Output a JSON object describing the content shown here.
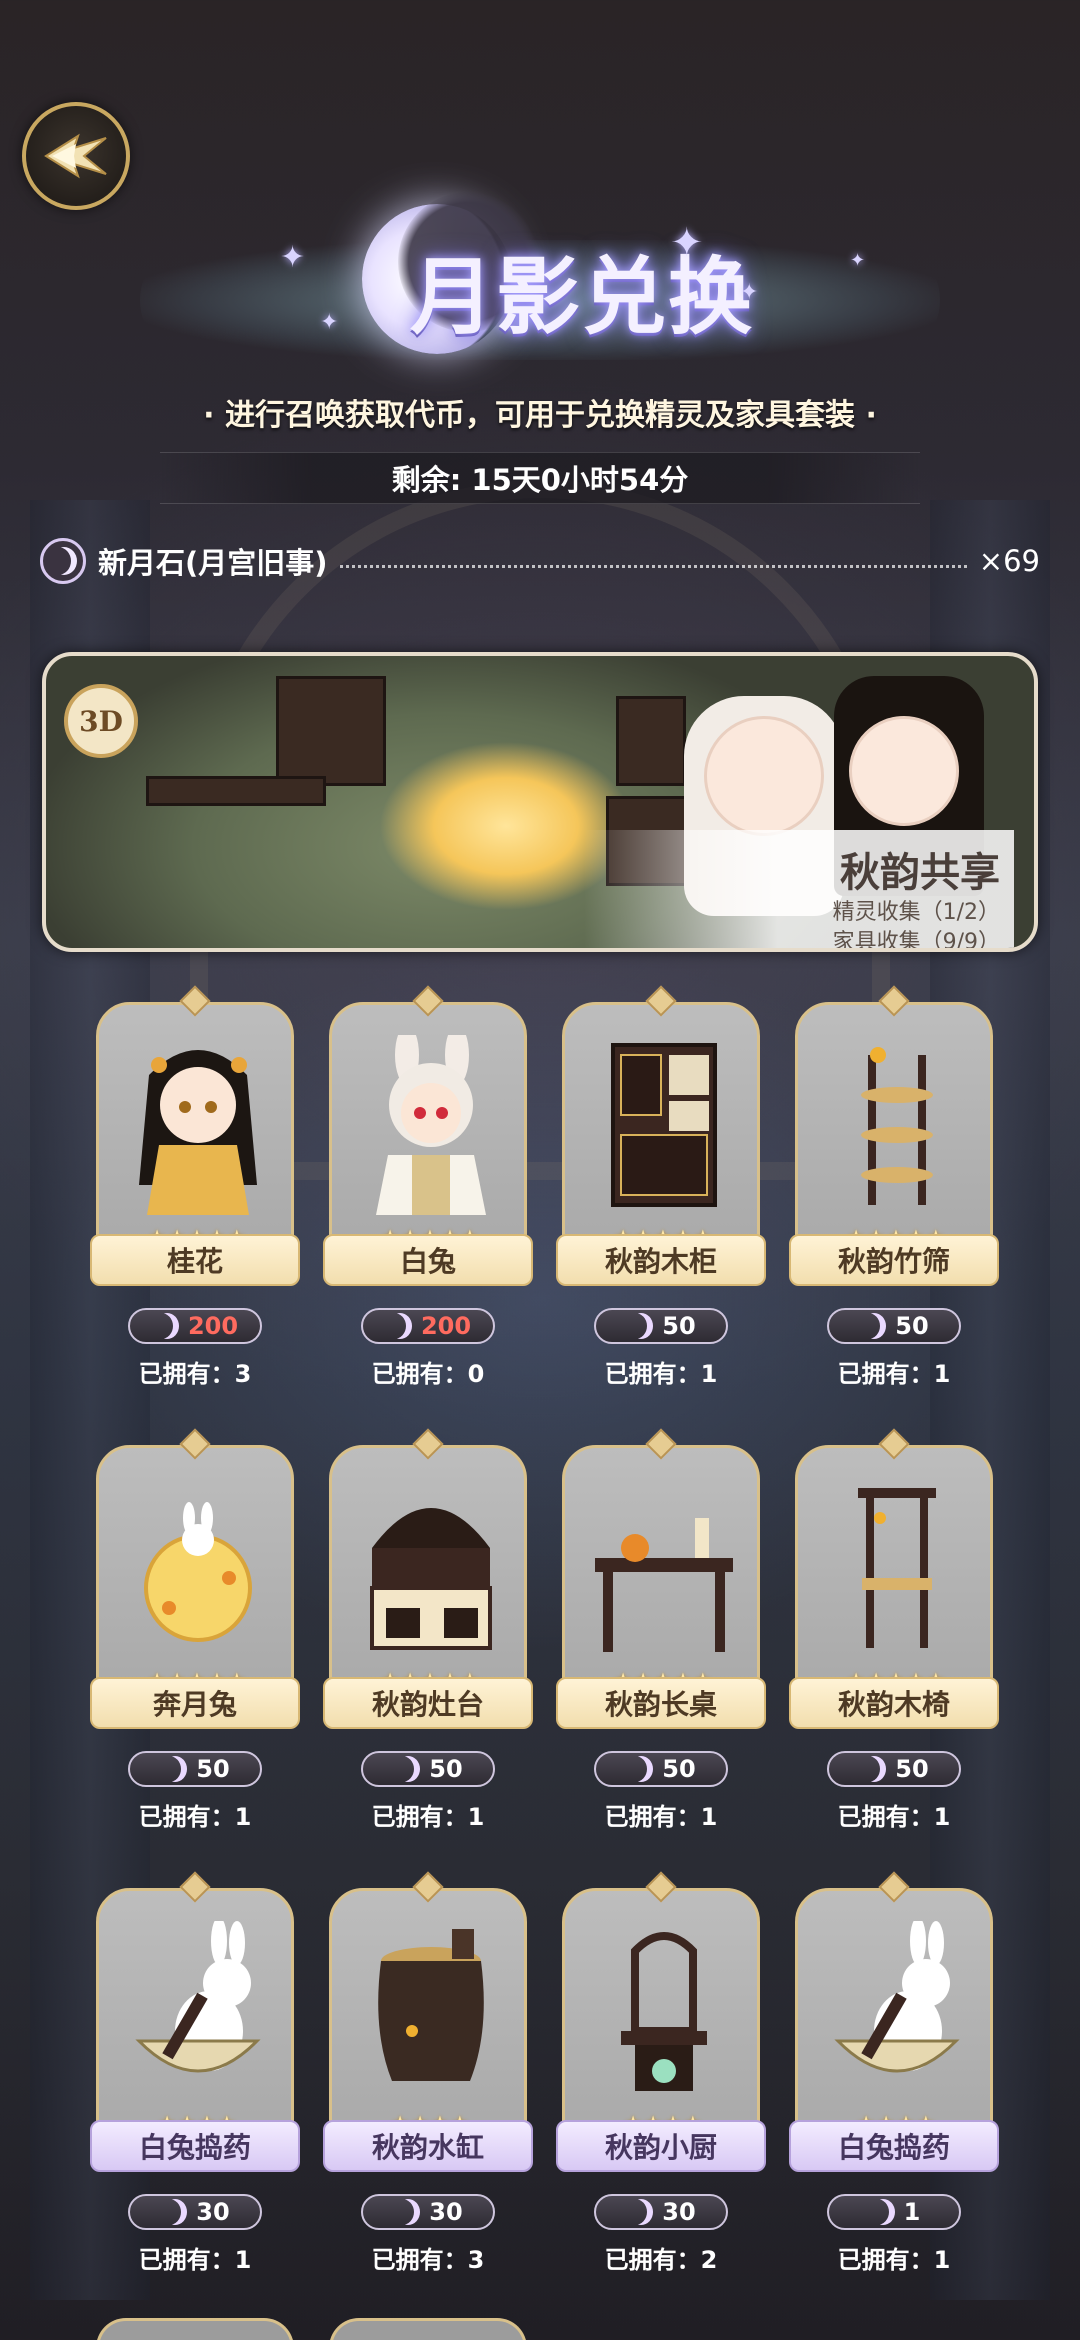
{
  "header": {
    "title": "月影兑换",
    "subtitle": "· 进行召唤获取代币，可用于兑换精灵及家具套装 ·",
    "remaining": "剩余: 15天0小时54分"
  },
  "currency": {
    "name": "新月石(月宫旧事)",
    "count": "×69"
  },
  "banner": {
    "badge": "3D",
    "set_name": "秋韵共享",
    "spirit_collect": "精灵收集（1/2）",
    "furniture_collect": "家具收集（9/9）"
  },
  "items": [
    {
      "name": "桂花",
      "price": "200",
      "owned": "已拥有：3",
      "stars": "★★★★★",
      "plate": "gold",
      "price_red": true,
      "art": "girl"
    },
    {
      "name": "白兔",
      "price": "200",
      "owned": "已拥有：0",
      "stars": "★★★★★",
      "plate": "gold",
      "price_red": true,
      "art": "bunnyboy"
    },
    {
      "name": "秋韵木柜",
      "price": "50",
      "owned": "已拥有：1",
      "stars": "★★★★★",
      "plate": "gold",
      "price_red": false,
      "art": "cabinet"
    },
    {
      "name": "秋韵竹筛",
      "price": "50",
      "owned": "已拥有：1",
      "stars": "★★★★★",
      "plate": "gold",
      "price_red": false,
      "art": "sieve"
    },
    {
      "name": "奔月兔",
      "price": "50",
      "owned": "已拥有：1",
      "stars": "★★★★★",
      "plate": "gold",
      "price_red": false,
      "art": "moonrabbit"
    },
    {
      "name": "秋韵灶台",
      "price": "50",
      "owned": "已拥有：1",
      "stars": "★★★★★",
      "plate": "gold",
      "price_red": false,
      "art": "stove"
    },
    {
      "name": "秋韵长桌",
      "price": "50",
      "owned": "已拥有：1",
      "stars": "★★★★★",
      "plate": "gold",
      "price_red": false,
      "art": "table"
    },
    {
      "name": "秋韵木椅",
      "price": "50",
      "owned": "已拥有：1",
      "stars": "★★★★★",
      "plate": "gold",
      "price_red": false,
      "art": "chair"
    },
    {
      "name": "白兔捣药",
      "price": "30",
      "owned": "已拥有：1",
      "stars": "★★★★",
      "plate": "purple",
      "price_red": false,
      "art": "rabbitmortar"
    },
    {
      "name": "秋韵水缸",
      "price": "30",
      "owned": "已拥有：3",
      "stars": "★★★★",
      "plate": "purple",
      "price_red": false,
      "art": "jar"
    },
    {
      "name": "秋韵小厨",
      "price": "30",
      "owned": "已拥有：2",
      "stars": "★★★★",
      "plate": "purple",
      "price_red": false,
      "art": "kitchen"
    },
    {
      "name": "白兔捣药",
      "price": "1",
      "owned": "已拥有：1",
      "stars": "★★★★",
      "plate": "purple",
      "price_red": false,
      "art": "rabbitmortar"
    }
  ],
  "icons": {
    "back": "back-arrow-icon",
    "currency": "crescent-moon-icon"
  },
  "colors": {
    "gold_border": "#d8c08a",
    "price_red": "#ff6b5f",
    "title_glow": "#a9a2ff"
  }
}
